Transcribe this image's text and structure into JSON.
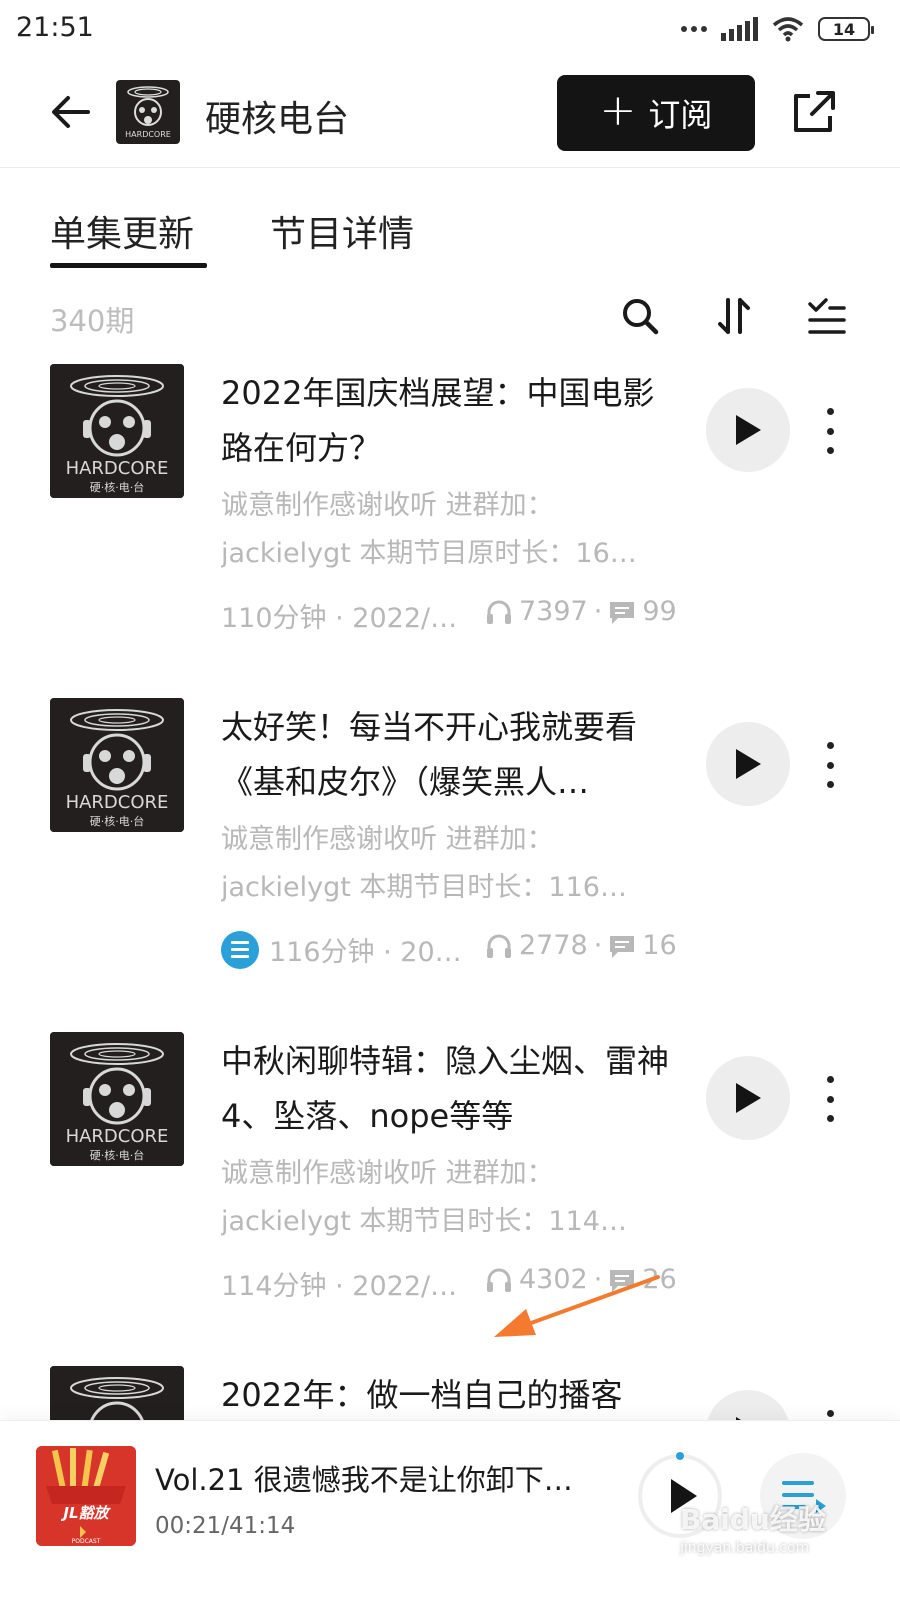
{
  "status_bar": {
    "time": "21:51",
    "battery": "14"
  },
  "header": {
    "title": "硬核电台",
    "subscribe_label": "订阅"
  },
  "tabs": [
    {
      "label": "单集更新"
    },
    {
      "label": "节目详情"
    }
  ],
  "list": {
    "episode_count": "340期"
  },
  "episodes": [
    {
      "title": "2022年国庆档展望：中国电影路在何方？",
      "desc_line1": "诚意制作感谢收听 进群加：",
      "desc_line2": "jackielygt 本期节目原时长：16…",
      "meta": "110分钟 · 2022/…",
      "plays": "7397",
      "comments": "99"
    },
    {
      "title": "太好笑！每当不开心我就要看《基和皮尔》（爆笑黑人…",
      "desc_line1": "诚意制作感谢收听 进群加：",
      "desc_line2": "jackielygt 本期节目时长：116…",
      "meta": "116分钟 · 20…",
      "plays": "2778",
      "comments": "16"
    },
    {
      "title": "中秋闲聊特辑：隐入尘烟、雷神4、坠落、nope等等",
      "desc_line1": "诚意制作感谢收听 进群加：",
      "desc_line2": "jackielygt 本期节目时长：114…",
      "meta": "114分钟 · 2022/…",
      "plays": "4302",
      "comments": "26"
    },
    {
      "title": "2022年：做一档自己的播客"
    }
  ],
  "mini_player": {
    "title": "Vol.21 很遗憾我不是让你卸下…",
    "time": "00:21/41:14"
  },
  "cover_art": {
    "brand_text": "HARDCORE",
    "brand_sub": "硬·核·电·台"
  },
  "mini_cover_art": {
    "brand_text": "JL豁放",
    "badge": "PODCAST"
  },
  "watermark": {
    "brand": "Baidu经验",
    "url": "jingyan.baidu.com"
  },
  "colors": {
    "accent": "#141414",
    "tag_blue": "#2a9fd8",
    "arrow": "#f47a2f",
    "muted": "#b8b8b8"
  }
}
